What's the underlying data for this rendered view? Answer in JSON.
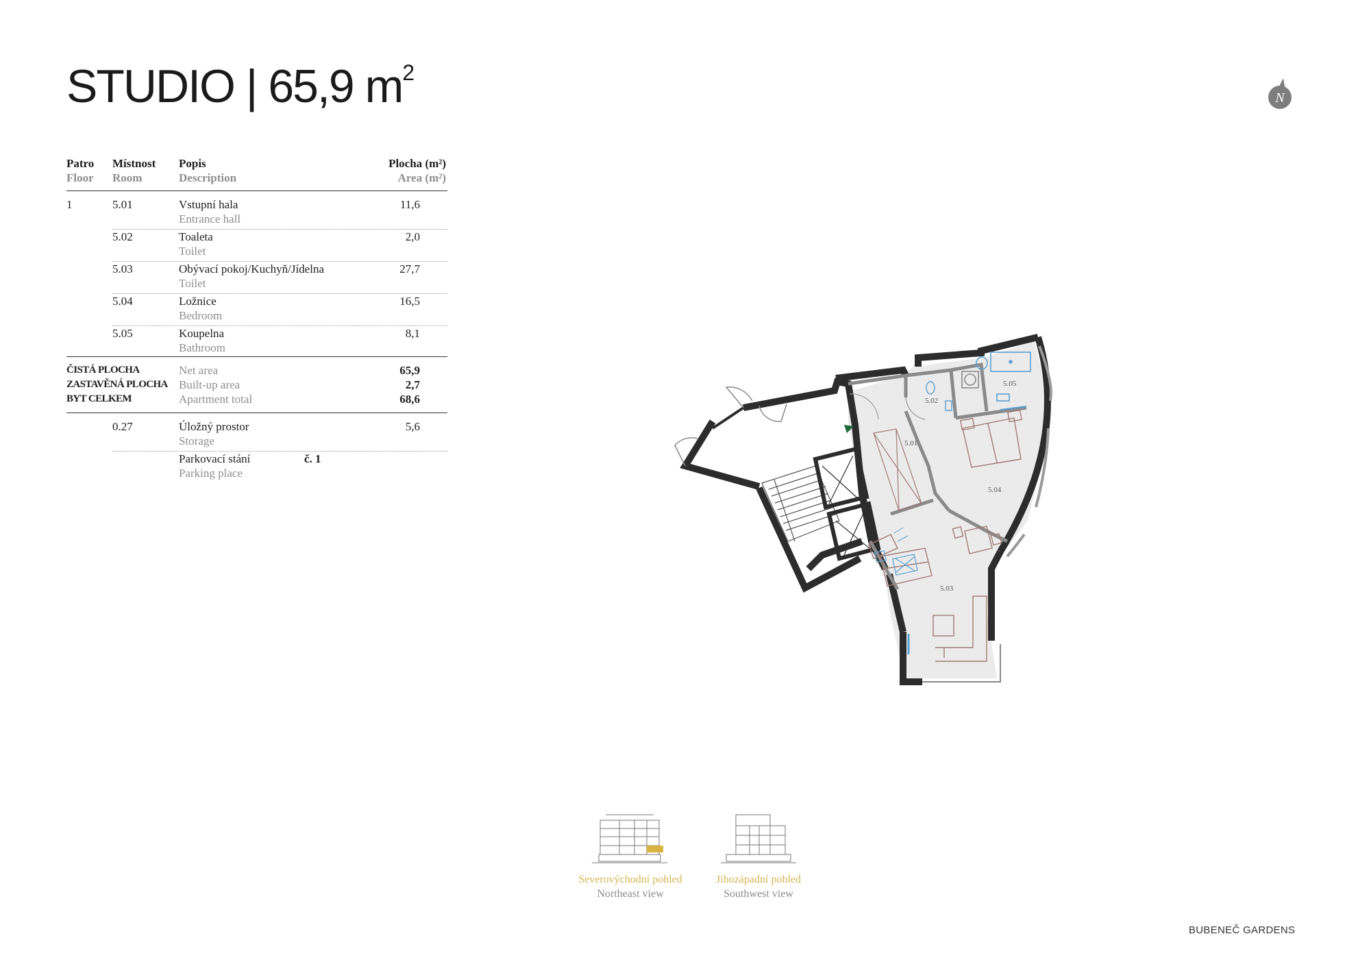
{
  "title": {
    "text": "STUDIO | 65,9 m",
    "sup": "2"
  },
  "compass": {
    "letter": "N"
  },
  "table": {
    "headers": {
      "floor_cz": "Patro",
      "floor_en": "Floor",
      "room_cz": "Místnost",
      "room_en": "Room",
      "desc_cz": "Popis",
      "desc_en": "Description",
      "area_cz": "Plocha (m²)",
      "area_en": "Area (m²)"
    },
    "floor": "1",
    "rows": [
      {
        "room": "5.01",
        "desc_cz": "Vstupní hala",
        "desc_en": "Entrance hall",
        "area": "11,6"
      },
      {
        "room": "5.02",
        "desc_cz": "Toaleta",
        "desc_en": "Toilet",
        "area": "2,0"
      },
      {
        "room": "5.03",
        "desc_cz": "Obývací pokoj/Kuchyň/Jídelna",
        "desc_en": "Toilet",
        "area": "27,7"
      },
      {
        "room": "5.04",
        "desc_cz": "Ložnice",
        "desc_en": "Bedroom",
        "area": "16,5"
      },
      {
        "room": "5.05",
        "desc_cz": "Koupelna",
        "desc_en": "Bathroom",
        "area": "8,1"
      }
    ],
    "summary": [
      {
        "label_cz": "ČISTÁ PLOCHA",
        "label_en": "Net area",
        "value": "65,9"
      },
      {
        "label_cz": "ZASTAVĚNÁ PLOCHA",
        "label_en": "Built-up area",
        "value": "2,7"
      },
      {
        "label_cz": "BYT CELKEM",
        "label_en": "Apartment total",
        "value": "68,6"
      }
    ],
    "extras": [
      {
        "room": "0.27",
        "desc_cz": "Úložný prostor",
        "desc_en": "Storage",
        "area": "5,6",
        "note": ""
      },
      {
        "room": "",
        "desc_cz": "Parkovací stání",
        "desc_en": "Parking place",
        "area": "",
        "note": "č. 1"
      }
    ]
  },
  "plan": {
    "room_labels": {
      "r501": "5.01",
      "r502": "5.02",
      "r503": "5.03",
      "r504": "5.04",
      "r505": "5.05"
    },
    "colors": {
      "wall": "#2c2c2c",
      "floor": "#ebebeb",
      "furniture": "#a07a74",
      "sanitary": "#5aa0d2",
      "entry_arrow": "#1f6b3a"
    }
  },
  "views": {
    "northeast": {
      "cz": "Severovýchodní pohled",
      "en": "Northeast view",
      "highlight": "#d9b33f"
    },
    "southwest": {
      "cz": "Jihozápadní pohled",
      "en": "Southwest view"
    }
  },
  "brand": "BUBENEČ GARDENS"
}
